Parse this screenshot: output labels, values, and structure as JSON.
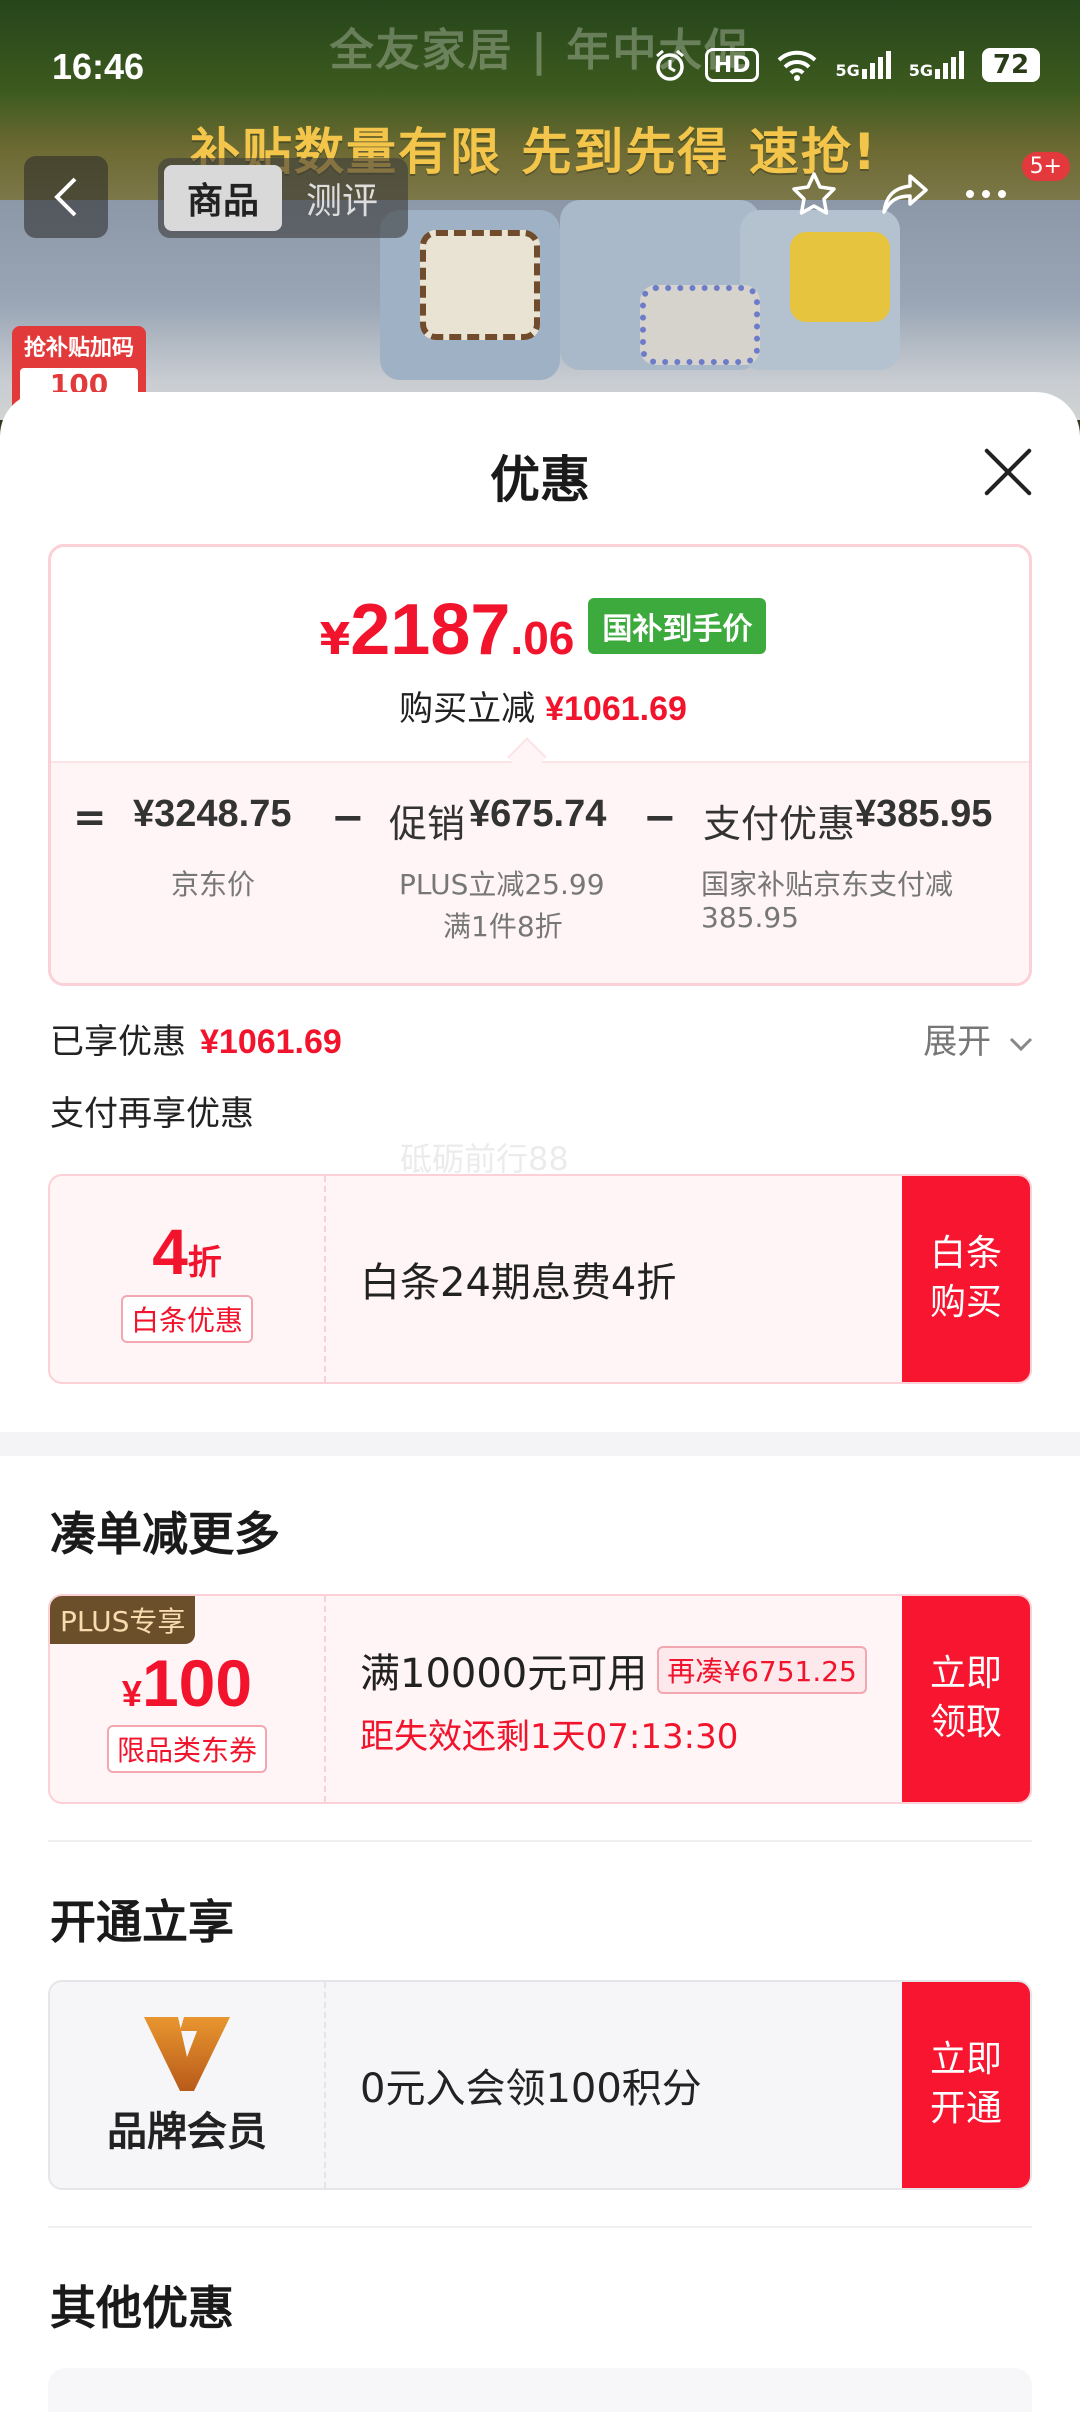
{
  "status_bar": {
    "time": "16:46",
    "battery": "72",
    "hd": "HD",
    "net1": "5G",
    "net2": "5G"
  },
  "banner": {
    "title": "全友家居 | 年中大促",
    "promo": "补贴数量有限 先到先得 速抢!"
  },
  "nav": {
    "tab_product": "商品",
    "tab_review": "测评",
    "badge": "5+"
  },
  "coupon_tag": {
    "line1": "抢补贴加码",
    "line2": "100"
  },
  "sheet": {
    "title": "优惠"
  },
  "price_card": {
    "yen": "¥",
    "price_int": "2187",
    "price_dec": ".06",
    "price_tag": "国补到手价",
    "reduce_label": "购买立减",
    "reduce_value": "¥1061.69",
    "eq": "=",
    "minus": "−",
    "jd_price": "¥3248.75",
    "jd_caption": "京东价",
    "promo_label": "促销",
    "promo_value": "¥675.74",
    "promo_caption1": "PLUS立减25.99",
    "promo_caption2": "满1件8折",
    "pay_label": "支付优惠",
    "pay_value": "¥385.95",
    "pay_caption1": "国家补贴京东支付减",
    "pay_caption2": "385.95"
  },
  "enjoyed": {
    "label": "已享优惠",
    "value": "¥1061.69",
    "expand": "展开"
  },
  "pay_more": {
    "title": "支付再享优惠",
    "watermark": "砥砺前行88"
  },
  "baitiao": {
    "discount_num": "4",
    "discount_unit": "折",
    "tag": "白条优惠",
    "desc": "白条24期息费4折",
    "btn_line1": "白条",
    "btn_line2": "购买"
  },
  "section_more": {
    "title": "凑单减更多"
  },
  "plus_coupon": {
    "label": "PLUS专享",
    "yen": "¥",
    "amount": "100",
    "tag": "限品类东券",
    "desc": "满10000元可用",
    "again": "再凑¥6751.25",
    "countdown": "距失效还剩1天07:13:30",
    "btn_line1": "立即",
    "btn_line2": "领取"
  },
  "section_open": {
    "title": "开通立享"
  },
  "member": {
    "brand": "品牌会员",
    "desc": "0元入会领100积分",
    "btn_line1": "立即",
    "btn_line2": "开通"
  },
  "section_other": {
    "title": "其他优惠"
  },
  "colors": {
    "red": "#f2142c",
    "button_red": "#f7152f",
    "green_tag": "#3daa3e",
    "plus_brown": "#6b4e2a",
    "brand_orange": "#d9822b"
  }
}
